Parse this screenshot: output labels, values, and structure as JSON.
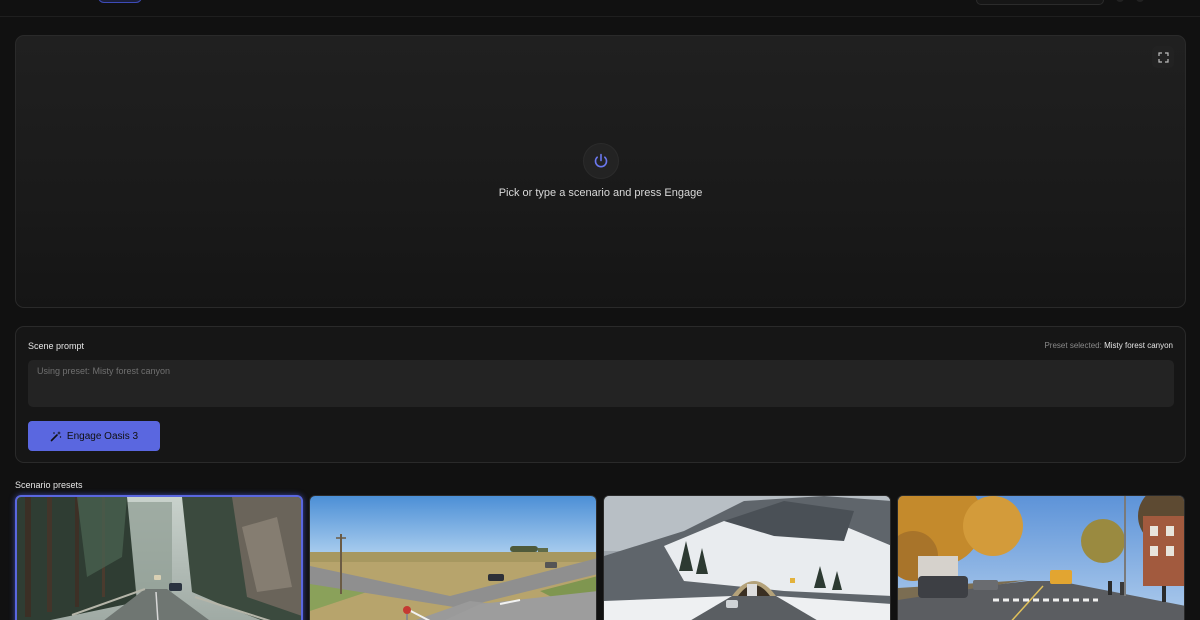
{
  "viewer": {
    "message": "Pick or type a scenario and press Engage"
  },
  "prompt": {
    "label": "Scene prompt",
    "preset_prefix": "Preset selected:",
    "preset_value": "Misty forest canyon",
    "placeholder": "Using preset: Misty forest canyon",
    "value": "",
    "engage_label": "Engage Oasis 3"
  },
  "presets": {
    "title": "Scenario presets",
    "selected_index": 0,
    "tiles": [
      {
        "scene": "forest-road"
      },
      {
        "scene": "prairie-intersection"
      },
      {
        "scene": "snowy-tunnel"
      },
      {
        "scene": "autumn-street"
      }
    ]
  },
  "colors": {
    "accent": "#5a67e0",
    "background": "#111111",
    "panel": "#161616"
  },
  "icons": {
    "power": "power-icon",
    "fullscreen": "fullscreen-icon",
    "engage": "magic-wand-icon"
  }
}
